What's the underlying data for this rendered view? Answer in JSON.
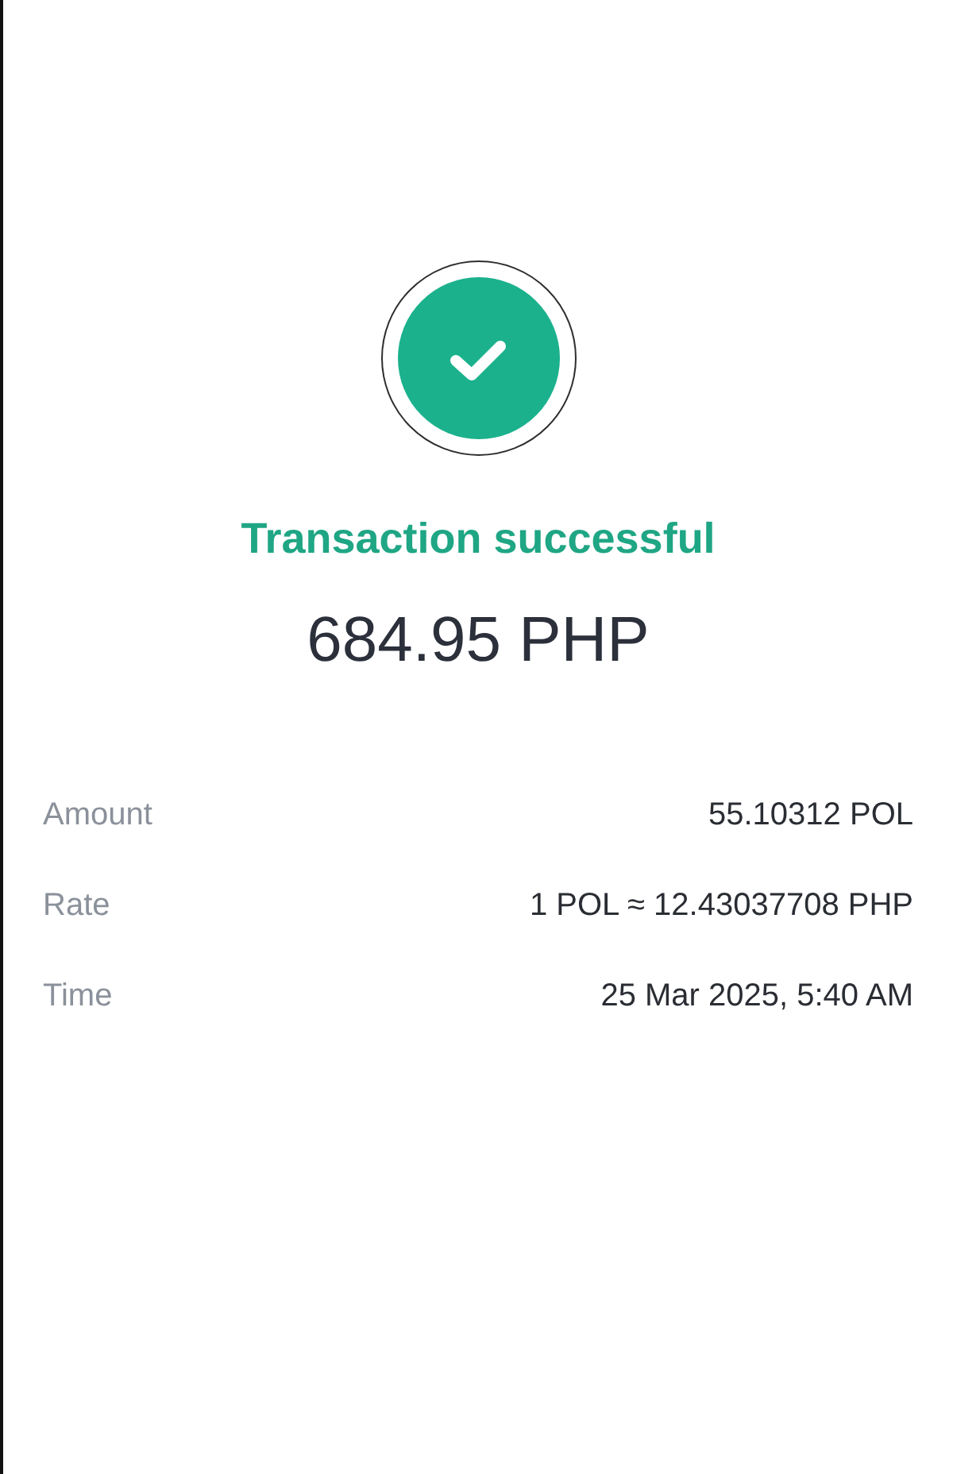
{
  "status": {
    "title": "Transaction successful",
    "amount": "684.95 PHP"
  },
  "details": [
    {
      "label": "Amount",
      "value": "55.10312 POL"
    },
    {
      "label": "Rate",
      "value": "1 POL ≈ 12.43037708 PHP"
    },
    {
      "label": "Time",
      "value": "25 Mar 2025, 5:40 AM"
    }
  ]
}
